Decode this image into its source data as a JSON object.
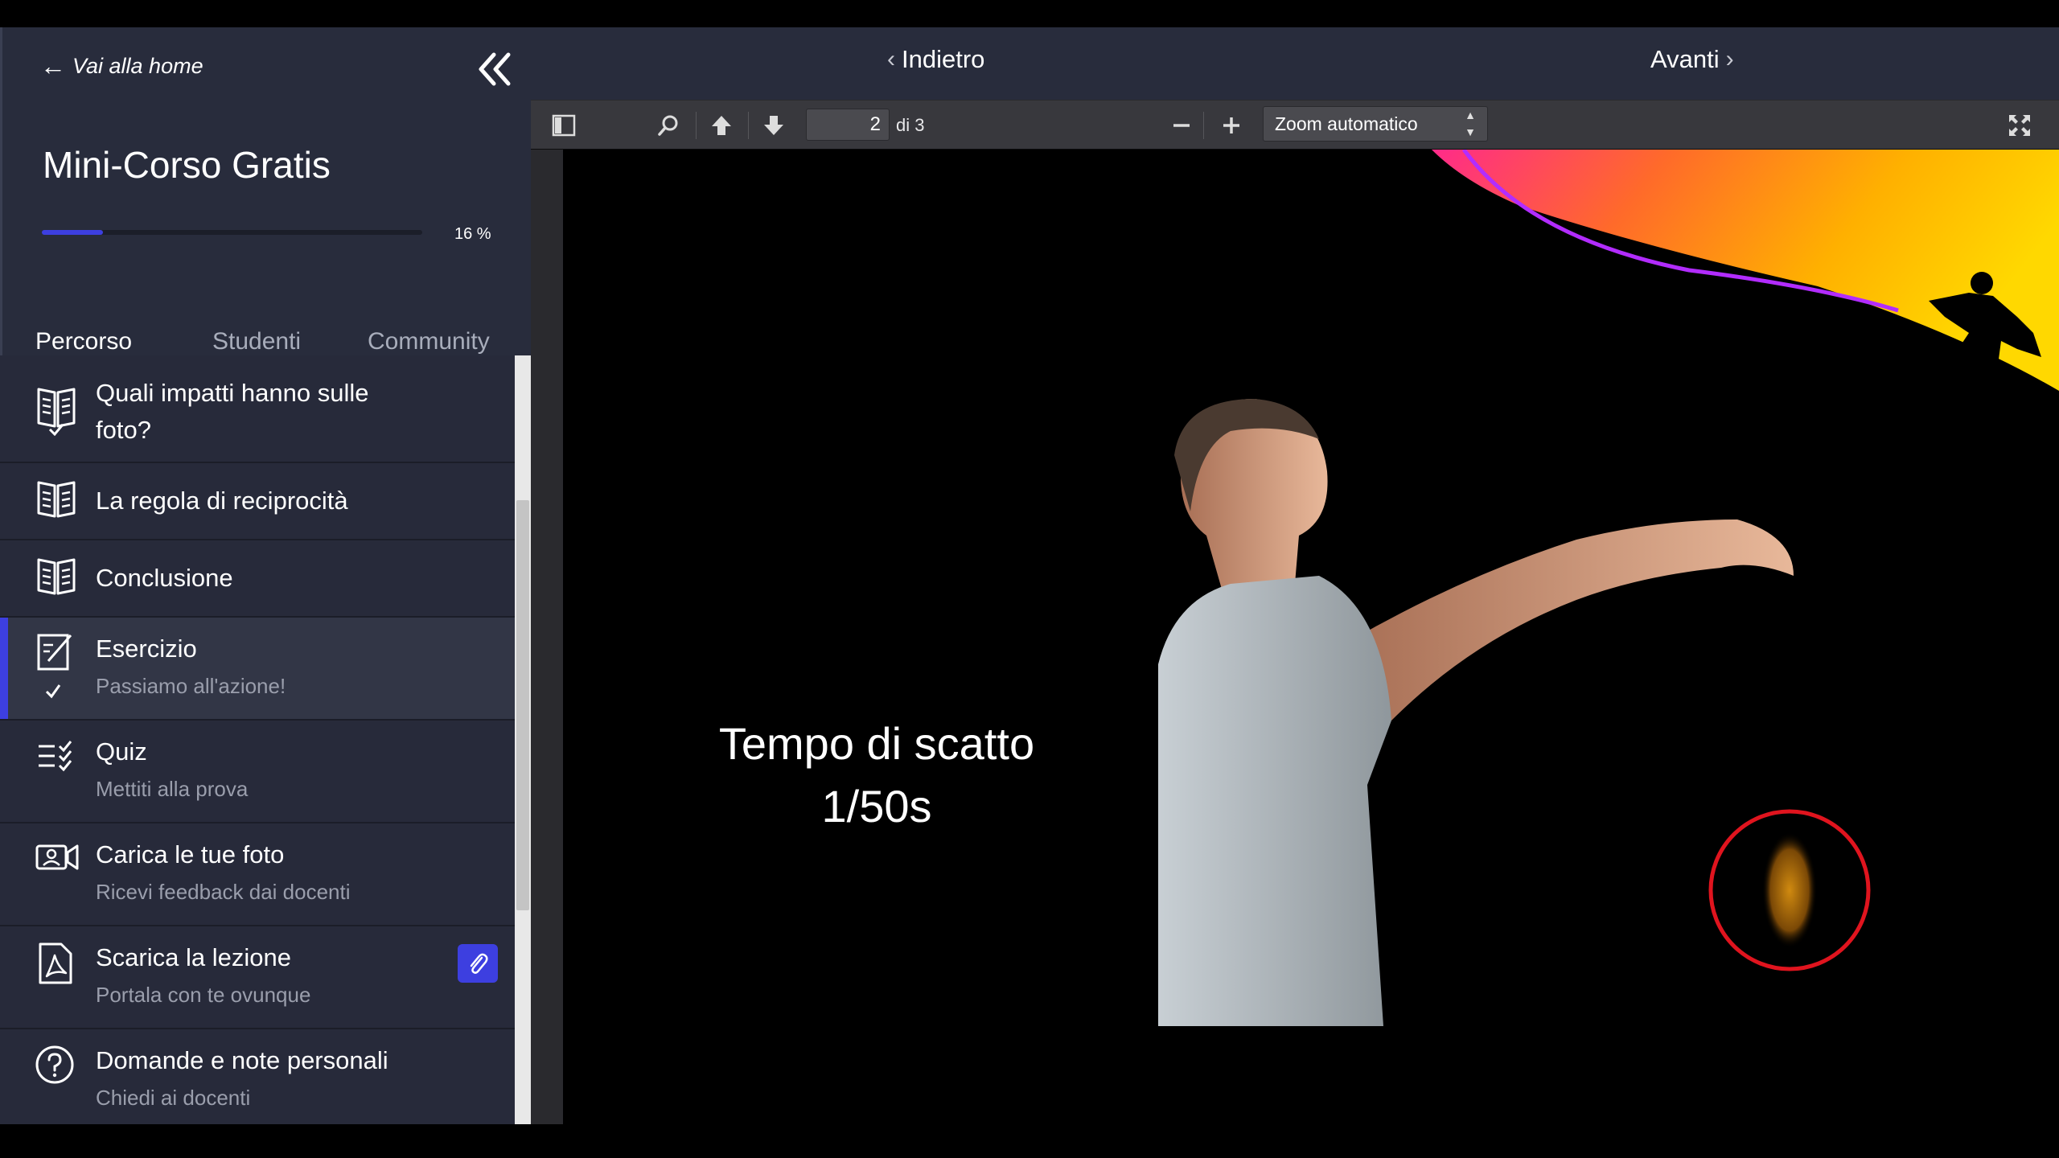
{
  "sidebar": {
    "back_home": "Vai alla home",
    "course_title": "Mini-Corso Gratis",
    "progress_percent": 16,
    "progress_label": "16 %",
    "tabs": [
      "Percorso",
      "Studenti",
      "Community"
    ],
    "lessons": [
      {
        "title_line1": "Quali impatti hanno sulle",
        "title_line2": "foto?",
        "icon": "book-check-icon"
      },
      {
        "title": "La regola di reciprocità",
        "icon": "book-icon"
      },
      {
        "title": "Conclusione",
        "icon": "book-icon"
      },
      {
        "title": "Esercizio",
        "subtitle": "Passiamo all'azione!",
        "icon": "edit-check-icon",
        "active": true
      },
      {
        "title": "Quiz",
        "subtitle": "Mettiti alla prova",
        "icon": "checklist-icon"
      },
      {
        "title": "Carica le tue foto",
        "subtitle": "Ricevi feedback dai docenti",
        "icon": "photo-upload-icon"
      },
      {
        "title": "Scarica la lezione",
        "subtitle": "Portala con te ovunque",
        "icon": "pdf-icon",
        "attachment_icon": "paperclip-icon"
      },
      {
        "title": "Domande e note personali",
        "subtitle": "Chiedi ai docenti",
        "icon": "question-icon"
      }
    ]
  },
  "viewer": {
    "prev_label": "Indietro",
    "next_label": "Avanti",
    "toolbar": {
      "page_value": "2",
      "page_total": "di 3",
      "zoom": "Zoom automatico"
    },
    "slide": {
      "line1": "Tempo di scatto",
      "line2": "1/50s"
    }
  },
  "colors": {
    "sidebar_bg": "#282c3c",
    "accent": "#3d3fe0",
    "toolbar_bg": "#38383d",
    "highlight_circle": "#e0141e"
  }
}
